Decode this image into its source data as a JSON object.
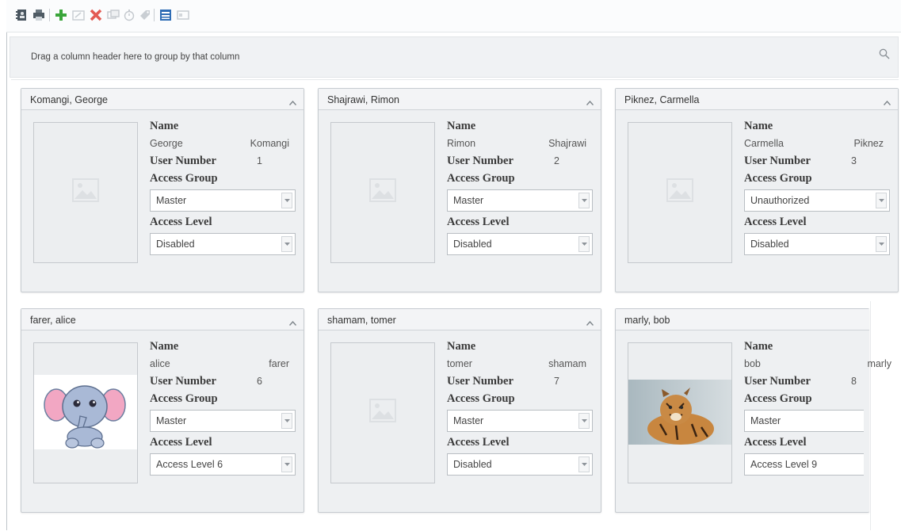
{
  "toolbar": {
    "icons": [
      "address-book-icon",
      "printer-icon",
      "add-icon",
      "edit-icon",
      "delete-icon",
      "copy-icon",
      "timer-icon",
      "tag-icon",
      "card-view-icon",
      "list-view-icon"
    ]
  },
  "groupbar": {
    "hint": "Drag a column header here to group by that column"
  },
  "labels": {
    "name": "Name",
    "user_number": "User Number",
    "access_group": "Access Group",
    "access_level": "Access Level"
  },
  "cards": [
    {
      "title": "Komangi, George",
      "first": "George",
      "last": "Komangi",
      "number": "1",
      "group": "Master",
      "level": "Disabled",
      "photo": "placeholder"
    },
    {
      "title": "Shajrawi, Rimon",
      "first": "Rimon",
      "last": "Shajrawi",
      "number": "2",
      "group": "Master",
      "level": "Disabled",
      "photo": "placeholder"
    },
    {
      "title": "Piknez, Carmella",
      "first": "Carmella",
      "last": "Piknez",
      "number": "3",
      "group": "Unauthorized",
      "level": "Disabled",
      "photo": "placeholder"
    },
    {
      "title": "farer, alice",
      "first": "alice",
      "last": "farer",
      "number": "6",
      "group": "Master",
      "level": "Access Level 6",
      "photo": "elephant"
    },
    {
      "title": "shamam, tomer",
      "first": "tomer",
      "last": "shamam",
      "number": "7",
      "group": "Master",
      "level": "Disabled",
      "photo": "placeholder"
    },
    {
      "title": "marly, bob",
      "first": "bob",
      "last": "marly",
      "number": "8",
      "group": "Master",
      "level": "Access Level 9",
      "photo": "tiger"
    }
  ],
  "colors": {
    "card_bg": "#eef0f2",
    "add_green": "#3aa53a",
    "delete_red": "#d9413a",
    "view_blue": "#2f6db5"
  }
}
